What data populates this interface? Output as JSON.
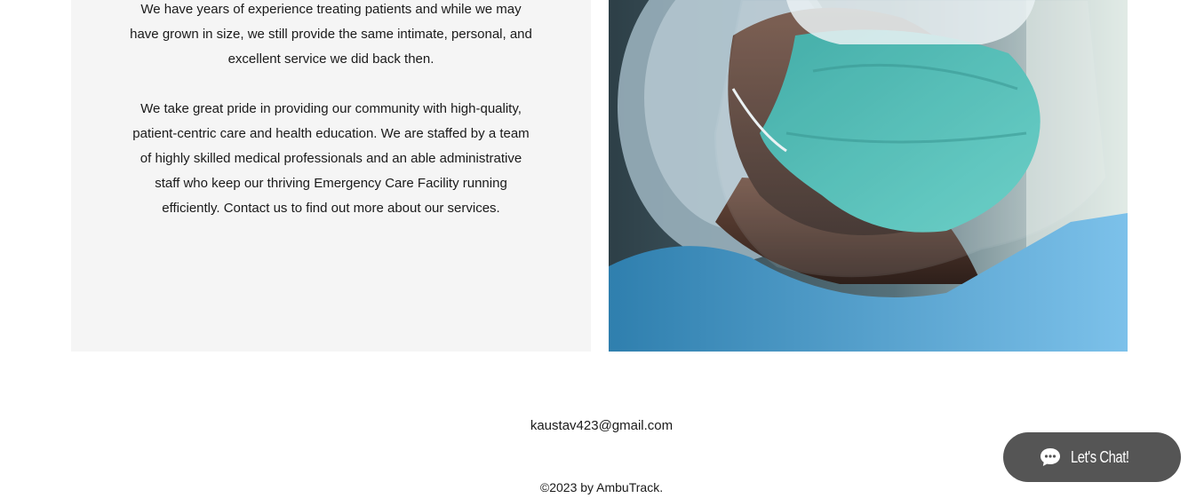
{
  "about": {
    "paragraph_1": [
      "We have years of experience treating patients and while we may",
      "have grown in size, we still provide the same intimate, personal, and",
      "excellent service we did back then."
    ],
    "paragraph_2": [
      "We take great pride in providing our community with high-quality,",
      "patient-centric care and health education. We are staffed by a team",
      "of highly skilled medical professionals and an able administrative",
      "staff who keep our thriving Emergency Care Facility running",
      "efficiently. Contact us to find out more about our services."
    ]
  },
  "footer": {
    "email": "kaustav423@gmail.com",
    "copyright": "©2023 by AmbuTrack."
  },
  "chat": {
    "label": "Let's Chat!",
    "icon": "chat-bubble-icon"
  },
  "colors": {
    "panel_bg": "#f5f5f5",
    "chat_bg": "#555555",
    "mask": "#3fb8b0",
    "scrubs": "#4aa3d8"
  }
}
